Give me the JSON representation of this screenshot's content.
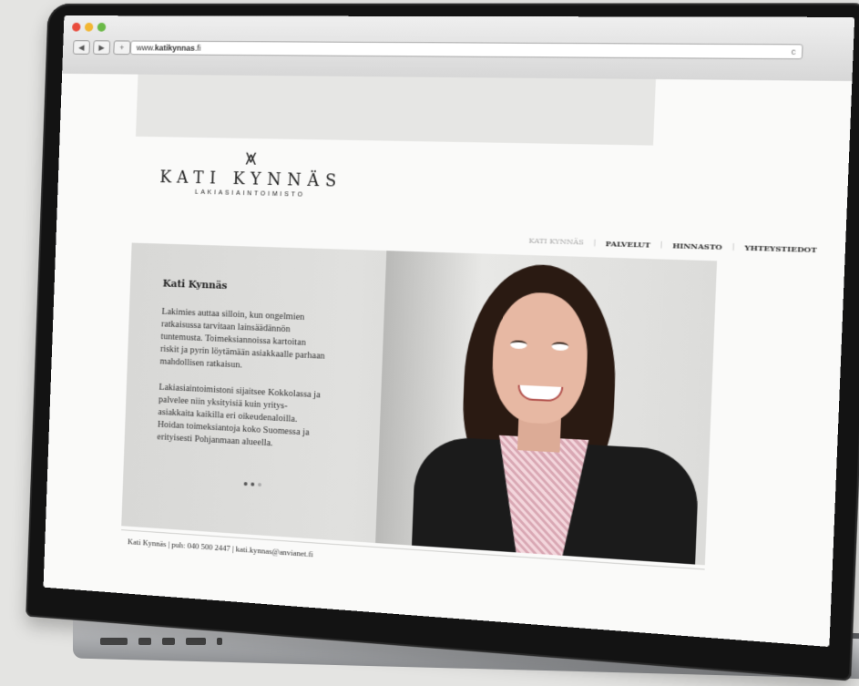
{
  "browser": {
    "nav_back": "◀",
    "nav_forward": "▶",
    "nav_add": "+",
    "url_prefix": "www.",
    "url_bold": "katikynnas",
    "url_suffix": ".fi",
    "reload": "c"
  },
  "site": {
    "logo_mark": "⩙",
    "logo_name": "KATI KYNNÄS",
    "logo_sub": "LAKIASIAINTOIMISTO",
    "nav": [
      {
        "label": "KATI KYNNÄS",
        "active": true
      },
      {
        "label": "PALVELUT"
      },
      {
        "label": "HINNASTO"
      },
      {
        "label": "YHTEYSTIEDOT"
      }
    ],
    "hero": {
      "title": "Kati Kynnäs",
      "paragraph1": "Lakimies auttaa silloin, kun ongelmien ratkaisussa tarvitaan lainsäädännön tuntemusta. Toimeksiannoissa kartoitan riskit ja pyrin löytämään asiakkaalle parhaan mahdollisen ratkaisun.",
      "paragraph2": "Lakiasiaintoimistoni sijaitsee Kokkolassa ja palvelee niin yksityisiä kuin yritys-asiakkaita kaikilla eri oikeudenaloilla. Hoidan toimeksiantoja koko Suomessa ja erityisesti Pohjanmaan alueella."
    },
    "footer": "Kati Kynnäs | puh: 040 500 2447 | kati.kynnas@anvianet.fi"
  },
  "colors": {
    "traffic_red": "#e94b3c",
    "traffic_yellow": "#f2b632",
    "traffic_green": "#6ab946"
  }
}
